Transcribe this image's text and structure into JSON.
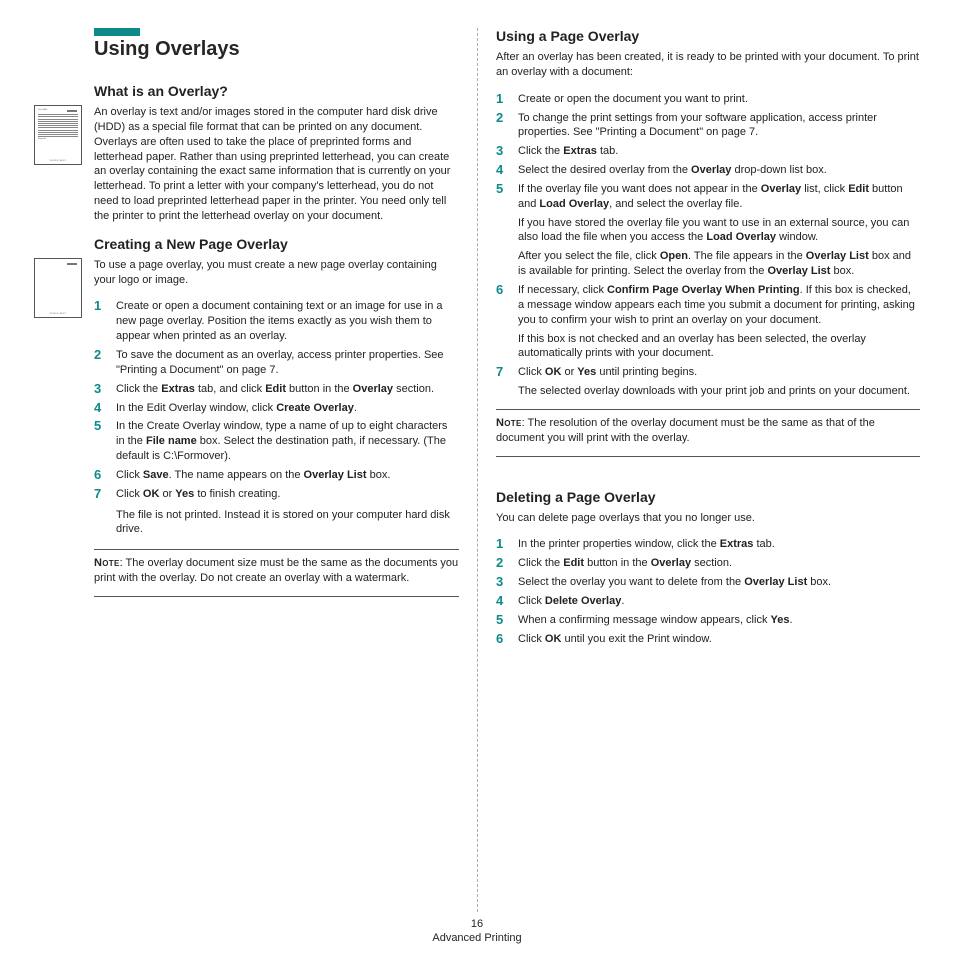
{
  "page_title": "Using Overlays",
  "left": {
    "what": {
      "heading": "What is an Overlay?",
      "body": "An overlay is text and/or images stored in the computer hard disk drive (HDD) as a special file format that can be printed on any document. Overlays are often used to take the place of preprinted forms and letterhead paper. Rather than using preprinted letterhead, you can create an overlay containing the exact same information that is currently on your letterhead. To print a letter with your company's letterhead, you do not need to load preprinted letterhead paper in the printer. You need only tell the printer to print the letterhead overlay on your document.",
      "thumb": {
        "title": "Dear ABC",
        "bottom": "WORLD BEST"
      }
    },
    "create": {
      "heading": "Creating a New Page Overlay",
      "intro": "To use a page overlay, you must create a new page overlay containing your logo or image.",
      "thumb": {
        "bottom": "WORLD BEST"
      },
      "steps": [
        "Create or open a document containing text or an image for use in a new page overlay. Position the items exactly as you wish them to appear when printed as an overlay.",
        "To save the document as an overlay, access printer properties. See \"Printing a Document\" on page 7.",
        "Click the <b>Extras</b> tab, and click <b>Edit</b> button in the <b>Overlay</b> section.",
        "In the Edit Overlay window, click <b>Create Overlay</b>.",
        "In the Create Overlay window, type a name of up to eight characters in the <b>File name</b> box. Select the destination path, if necessary. (The default is C:\\Formover).",
        "Click <b>Save</b>. The name appears on the <b>Overlay List</b> box.",
        "Click <b>OK</b> or <b>Yes</b> to finish creating."
      ],
      "after": "The file is not printed. Instead it is stored on your computer hard disk drive.",
      "note": "The overlay document size must be the same as the documents you print with the overlay. Do not create an overlay with a watermark."
    }
  },
  "right": {
    "using": {
      "heading": "Using a Page Overlay",
      "intro": "After an overlay has been created, it is ready to be printed with your document. To print an overlay with a document:",
      "steps": [
        {
          "t": "Create or open the document you want to print."
        },
        {
          "t": "To change the print settings from your software application, access printer properties. See \"Printing a Document\" on page 7."
        },
        {
          "t": "Click the <b>Extras</b> tab."
        },
        {
          "t": "Select the desired overlay from the <b>Overlay</b> drop-down list box."
        },
        {
          "t": "If the overlay file you want does not appear in the <b>Overlay</b> list, click <b>Edit</b> button and <b>Load Overlay</b>, and select the overlay file.",
          "subs": [
            "If you have stored the overlay file you want to use in an external source, you can also load the file when you access the <b>Load Overlay</b> window.",
            "After you select the file, click <b>Open</b>. The file appears in the <b>Overlay List</b> box and is available for printing. Select the overlay from the <b>Overlay List</b> box."
          ]
        },
        {
          "t": "If necessary, click <b>Confirm Page Overlay When Printing</b>. If this box is checked, a message window appears each time you submit a document for printing, asking you to confirm your wish to print an overlay on your document.",
          "subs": [
            "If this box is not checked and an overlay has been selected, the overlay automatically prints with your document."
          ]
        },
        {
          "t": "Click <b>OK</b> or <b>Yes</b> until printing begins.",
          "subs": [
            "The selected overlay downloads with your print job and prints on your document."
          ]
        }
      ],
      "note": "The resolution of the overlay document must be the same as that of the document you will print with the overlay."
    },
    "deleting": {
      "heading": "Deleting a Page Overlay",
      "intro": "You can delete page overlays that you no longer use.",
      "steps": [
        "In the printer properties window, click the <b>Extras</b> tab.",
        "Click the <b>Edit</b> button in the <b>Overlay</b> section.",
        "Select the overlay you want to delete from the <b>Overlay List</b> box.",
        "Click <b>Delete Overlay</b>.",
        "When a confirming message window appears, click <b>Yes</b>.",
        "Click <b>OK</b> until you exit the Print window."
      ]
    }
  },
  "footer": {
    "page_number": "16",
    "section": "Advanced Printing"
  },
  "note_label": "Note"
}
